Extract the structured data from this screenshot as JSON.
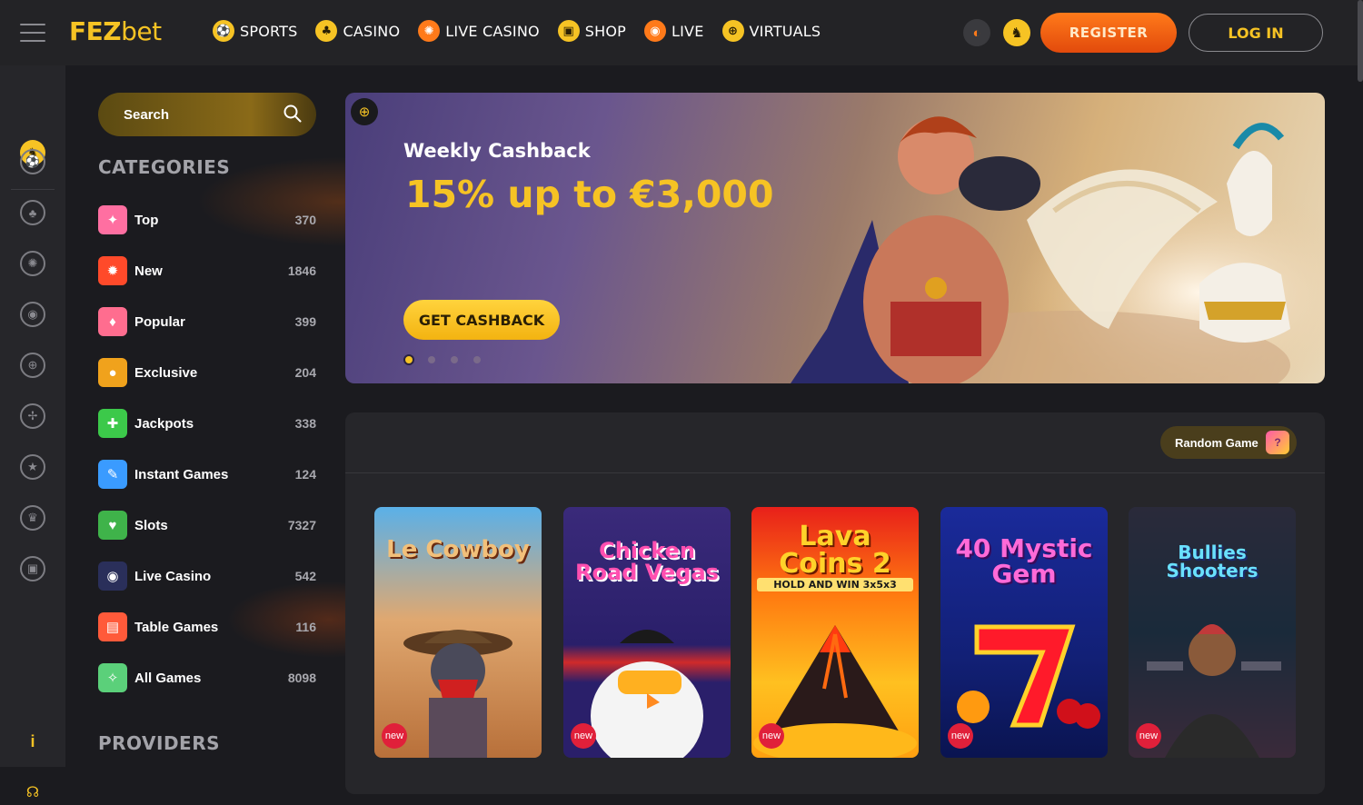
{
  "header": {
    "logo_bold": "FEZ",
    "logo_rest": "bet",
    "nav": [
      {
        "label": "SPORTS",
        "icon": "soccer-ball-icon"
      },
      {
        "label": "CASINO",
        "icon": "club-icon"
      },
      {
        "label": "LIVE CASINO",
        "icon": "roulette-icon"
      },
      {
        "label": "SHOP",
        "icon": "shopping-bag-icon"
      },
      {
        "label": "LIVE",
        "icon": "live-signal-icon"
      },
      {
        "label": "VIRTUALS",
        "icon": "virtuals-icon"
      }
    ],
    "register_label": "REGISTER",
    "login_label": "LOG IN"
  },
  "sidebar": {
    "search_placeholder": "Search",
    "categories_title": "CATEGORIES",
    "providers_title": "PROVIDERS",
    "categories": [
      {
        "label": "Top",
        "count": "370",
        "color": "#ff6fa1"
      },
      {
        "label": "New",
        "count": "1846",
        "color": "#ff4a2a"
      },
      {
        "label": "Popular",
        "count": "399",
        "color": "#ff6d8f"
      },
      {
        "label": "Exclusive",
        "count": "204",
        "color": "#f0a21c"
      },
      {
        "label": "Jackpots",
        "count": "338",
        "color": "#3cc94a"
      },
      {
        "label": "Instant Games",
        "count": "124",
        "color": "#3a9bff"
      },
      {
        "label": "Slots",
        "count": "7327",
        "color": "#3fb34a"
      },
      {
        "label": "Live Casino",
        "count": "542",
        "color": "#2a2f5a"
      },
      {
        "label": "Table Games",
        "count": "116",
        "color": "#ff5a3a"
      },
      {
        "label": "All Games",
        "count": "8098",
        "color": "#5bd07a"
      }
    ]
  },
  "banner": {
    "subtitle": "Weekly Cashback",
    "title": "15% up to €3,000",
    "button_label": "GET CASHBACK",
    "slides": 4,
    "active_slide": 1
  },
  "games": {
    "random_label": "Random Game",
    "badge_label": "new",
    "items": [
      {
        "title": "Le Cowboy",
        "colors": [
          "#5aa8e0",
          "#c47a3a"
        ]
      },
      {
        "title": "Chicken Road Vegas",
        "colors": [
          "#3a2a7a",
          "#2a1f5a"
        ]
      },
      {
        "title": "Lava Coins 2",
        "colors": [
          "#e02a10",
          "#ffb020"
        ]
      },
      {
        "title": "40 Mystic Gem",
        "colors": [
          "#1a2a8a",
          "#0e1a5a"
        ]
      },
      {
        "title": "Bullies Shooters",
        "colors": [
          "#1a2a3a",
          "#3a2a4a"
        ]
      }
    ],
    "subtitles": {
      "lava": "HOLD AND WIN 3x5x3"
    }
  }
}
